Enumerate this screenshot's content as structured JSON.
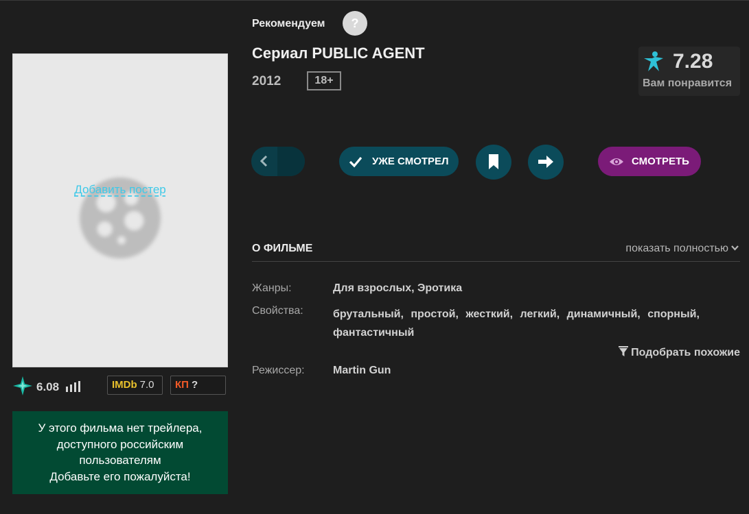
{
  "poster": {
    "add_link": "Добавить постер"
  },
  "ratings": {
    "site_rating": "6.08",
    "imdb_label": "IMDb",
    "imdb_value": "7.0",
    "kp_label": "КП",
    "kp_value": "?"
  },
  "trailer": {
    "lines": [
      "У этого фильма нет трейлера,",
      "доступного российским",
      "пользователям",
      "Добавьте его пожалуйста!"
    ]
  },
  "header": {
    "recommend": "Рекомендуем",
    "help": "?",
    "title": "Сериал PUBLIC AGENT",
    "year": "2012",
    "age": "18+"
  },
  "score": {
    "value": "7.28",
    "caption": "Вам понравится"
  },
  "actions": {
    "watched_label": "УЖЕ СМОТРЕЛ",
    "watch_label": "СМОТРЕТЬ"
  },
  "about": {
    "title": "О ФИЛЬМЕ",
    "show_more": "показать полностью",
    "genres_label": "Жанры:",
    "genres": [
      "Для взрослых,",
      "Эротика"
    ],
    "props_label": "Свойства:",
    "props": [
      "брутальный,",
      "простой,",
      "жесткий,",
      "легкий,",
      "динамичный,",
      "спорный,",
      "фантастичный"
    ],
    "similar": "Подобрать похожие",
    "director_label": "Режиссер:",
    "director": "Martin Gun"
  },
  "colors": {
    "background": "#1e1e1e",
    "teal": "#0b4b5a",
    "purple": "#7b1b78",
    "trailer_green": "#024a33",
    "link": "#3fc9e8"
  }
}
